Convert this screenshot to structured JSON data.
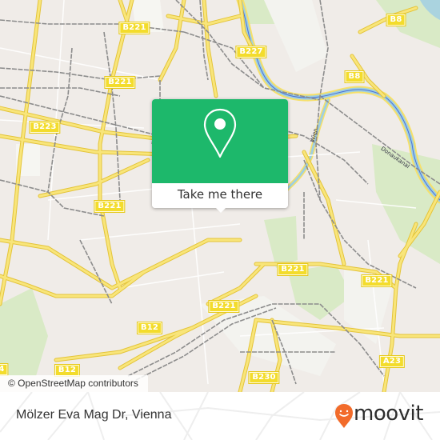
{
  "map": {
    "attribution": "© OpenStreetMap contributors",
    "road_shields": [
      {
        "label": "B221",
        "road": "B221"
      },
      {
        "label": "B221",
        "road": "B221"
      },
      {
        "label": "B223",
        "road": "B223"
      },
      {
        "label": "B221",
        "road": "B221"
      },
      {
        "label": "B227",
        "road": "B227"
      },
      {
        "label": "B8",
        "road": "B8"
      },
      {
        "label": "B8",
        "road": "B8"
      },
      {
        "label": "B221",
        "road": "B221"
      },
      {
        "label": "B221",
        "road": "B221"
      },
      {
        "label": "B221",
        "road": "B221"
      },
      {
        "label": "B12",
        "road": "B12"
      },
      {
        "label": "B12",
        "road": "B12"
      },
      {
        "label": "B230",
        "road": "B230"
      },
      {
        "label": "A23",
        "road": "A23"
      },
      {
        "label": "4",
        "road": "partial"
      }
    ],
    "water_labels": [
      {
        "label": "Wien"
      },
      {
        "label": "Donaukanal"
      }
    ],
    "colors": {
      "land": "#f0ece8",
      "road_major": "#f6e06a",
      "road_casing": "#e4c43a",
      "rail": "#8a8a8a",
      "water": "#aad3df",
      "park": "#d4e8c0"
    }
  },
  "popup": {
    "icon": "location-pin-icon",
    "button_label": "Take me there",
    "color": "#1db86b"
  },
  "footer": {
    "place_name": "Mölzer Eva Mag Dr, Vienna",
    "brand": "moovit",
    "brand_icon": "moovit-smile-pin-icon",
    "brand_color": "#f26b2a"
  }
}
